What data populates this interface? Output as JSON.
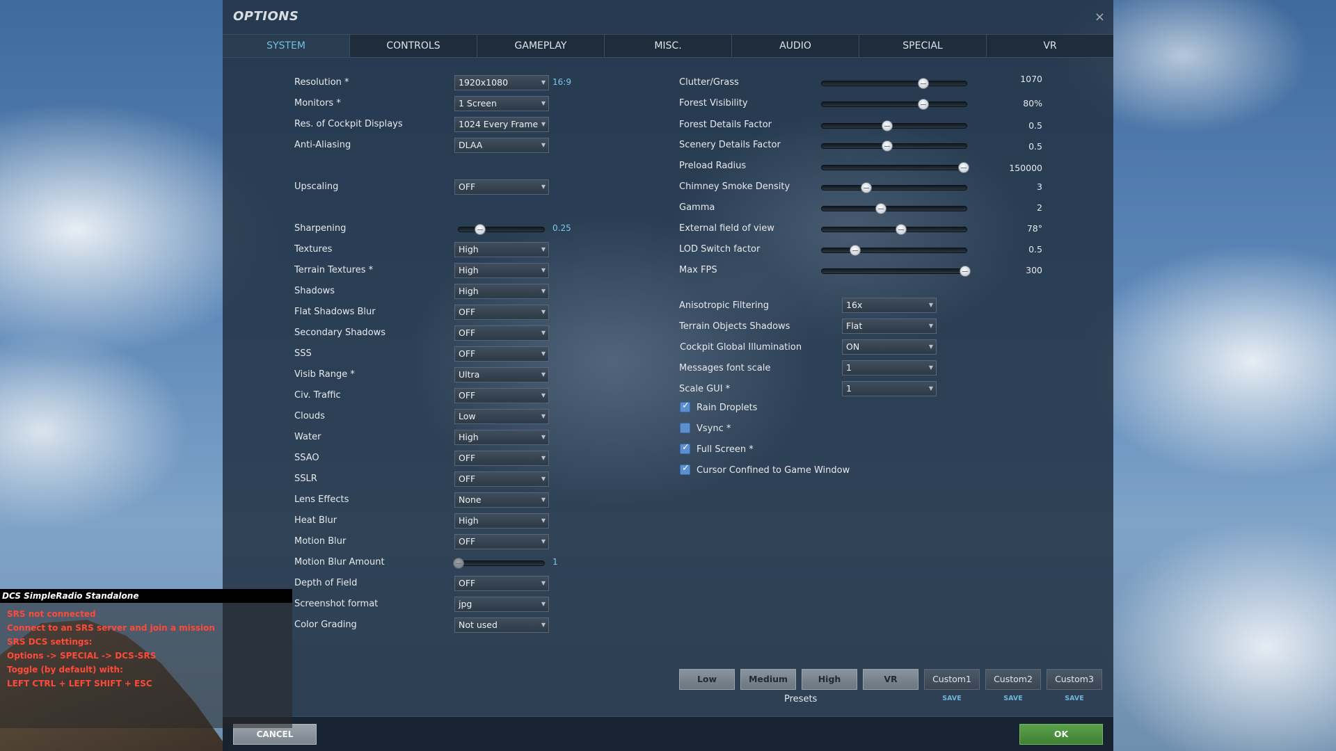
{
  "window": {
    "title": "OPTIONS",
    "close_glyph": "×"
  },
  "tabs": [
    {
      "label": "SYSTEM",
      "active": true
    },
    {
      "label": "CONTROLS"
    },
    {
      "label": "GAMEPLAY"
    },
    {
      "label": "MISC."
    },
    {
      "label": "AUDIO"
    },
    {
      "label": "SPECIAL"
    },
    {
      "label": "VR"
    }
  ],
  "left": {
    "resolution": {
      "label": "Resolution *",
      "value": "1920x1080",
      "aspect": "16:9"
    },
    "monitors": {
      "label": "Monitors *",
      "value": "1 Screen"
    },
    "cockpit_displays": {
      "label": "Res. of Cockpit Displays",
      "value": "1024 Every Frame"
    },
    "anti_aliasing": {
      "label": "Anti-Aliasing",
      "value": "DLAA"
    },
    "upscaling": {
      "label": "Upscaling",
      "value": "OFF"
    },
    "sharpening": {
      "label": "Sharpening",
      "value": "0.25",
      "fraction": 0.25
    },
    "textures": {
      "label": "Textures",
      "value": "High"
    },
    "terrain_textures": {
      "label": "Terrain Textures *",
      "value": "High"
    },
    "shadows": {
      "label": "Shadows",
      "value": "High"
    },
    "flat_shadows_blur": {
      "label": "Flat Shadows Blur",
      "value": "OFF"
    },
    "secondary_shadows": {
      "label": "Secondary Shadows",
      "value": "OFF"
    },
    "sss": {
      "label": "SSS",
      "value": "OFF"
    },
    "visib_range": {
      "label": "Visib Range *",
      "value": "Ultra"
    },
    "civ_traffic": {
      "label": "Civ. Traffic",
      "value": "OFF"
    },
    "clouds": {
      "label": "Clouds",
      "value": "Low"
    },
    "water": {
      "label": "Water",
      "value": "High"
    },
    "ssao": {
      "label": "SSAO",
      "value": "OFF"
    },
    "sslr": {
      "label": "SSLR",
      "value": "OFF"
    },
    "lens_effects": {
      "label": "Lens Effects",
      "value": "None"
    },
    "heat_blur": {
      "label": "Heat Blur",
      "value": "High"
    },
    "motion_blur": {
      "label": "Motion Blur",
      "value": "OFF"
    },
    "motion_blur_amount": {
      "label": "Motion Blur Amount",
      "value": "1",
      "fraction": 0.0
    },
    "depth_of_field": {
      "label": "Depth of Field",
      "value": "OFF"
    },
    "screenshot_format": {
      "label": "Screenshot format",
      "value": "jpg"
    },
    "color_grading": {
      "label": "Color Grading",
      "value": "Not used"
    }
  },
  "right_sliders": [
    {
      "label": "Clutter/Grass",
      "value": "1070",
      "fraction": 0.7
    },
    {
      "label": "Forest Visibility",
      "value": "80%",
      "fraction": 0.7
    },
    {
      "label": "Forest Details Factor",
      "value": "0.5",
      "fraction": 0.45
    },
    {
      "label": "Scenery Details Factor",
      "value": "0.5",
      "fraction": 0.45
    },
    {
      "label": "Preload Radius",
      "value": "150000",
      "fraction": 0.98
    },
    {
      "label": "Chimney Smoke Density",
      "value": "3",
      "fraction": 0.31
    },
    {
      "label": "Gamma",
      "value": "2",
      "fraction": 0.41
    },
    {
      "label": "External field of view",
      "value": "78°",
      "fraction": 0.55
    },
    {
      "label": "LOD Switch factor",
      "value": "0.5",
      "fraction": 0.23
    },
    {
      "label": "Max FPS",
      "value": "300",
      "fraction": 0.99
    }
  ],
  "right_dropdowns": [
    {
      "label": "Anisotropic Filtering",
      "value": "16x"
    },
    {
      "label": "Terrain Objects Shadows",
      "value": "Flat"
    },
    {
      "label": "Cockpit Global Illumination",
      "value": "ON"
    },
    {
      "label": "Messages font scale",
      "value": "1"
    },
    {
      "label": "Scale GUI *",
      "value": "1"
    }
  ],
  "checkboxes": [
    {
      "label": "Rain Droplets",
      "checked": true
    },
    {
      "label": "Vsync *",
      "checked": false
    },
    {
      "label": "Full Screen *",
      "checked": true
    },
    {
      "label": "Cursor Confined to Game Window",
      "checked": true
    }
  ],
  "presets": {
    "label": "Presets",
    "buttons": [
      "Low",
      "Medium",
      "High",
      "VR"
    ],
    "custom": [
      "Custom1",
      "Custom2",
      "Custom3"
    ],
    "save_label": "SAVE"
  },
  "footer": {
    "cancel": "CANCEL",
    "ok": "OK"
  },
  "srs": {
    "title": "DCS SimpleRadio Standalone",
    "lines": [
      "SRS not connected",
      "Connect to an SRS server and join a mission",
      "SRS DCS settings:",
      "Options -> SPECIAL -> DCS-SRS",
      "Toggle (by default) with:",
      "LEFT CTRL + LEFT SHIFT + ESC"
    ],
    "text_color": "#ff4a3a"
  },
  "colors": {
    "accent": "#6fc3e6",
    "ok_green": "#4a9a3c"
  },
  "icons": {
    "close": "close-icon",
    "dropdown": "chevron-down-icon",
    "check": "check-icon"
  }
}
